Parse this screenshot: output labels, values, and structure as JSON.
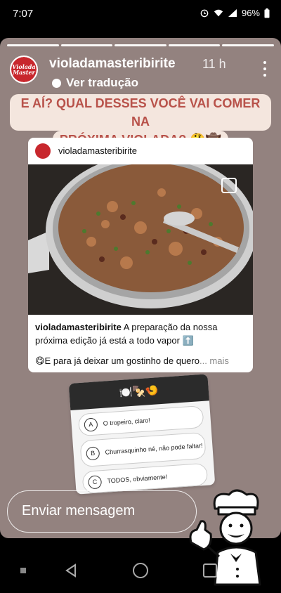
{
  "status": {
    "time": "7:07",
    "battery": "96%"
  },
  "story": {
    "username": "violadamasteribirite",
    "posted_ago": "11 h",
    "translate_label": "Ver tradução",
    "question_line1": "E AÍ? QUAL DESSES VOCÊ VAI COMER NA",
    "question_line2": "PRÓXIMA VIOLADA? 🤔🤠"
  },
  "post": {
    "username": "violadamasteribirite",
    "caption_user": "violadamasteribirite",
    "caption_text": " A preparação da nossa próxima edição já está a todo vapor ⬆️",
    "caption_text2": "😋E para já deixar um gostinho de quero",
    "caption_more": "... mais",
    "watermark": "Violada Master"
  },
  "avatar_text": "Violada Master",
  "poll": {
    "header": "🍽️🍢🍤",
    "options": [
      {
        "letter": "A",
        "text": "O tropeiro, claro!"
      },
      {
        "letter": "B",
        "text": "Churrasquinho né, não pode faltar!"
      },
      {
        "letter": "C",
        "text": "TODOS, obviamente!"
      }
    ]
  },
  "message": {
    "placeholder": "Enviar mensagem"
  },
  "colors": {
    "story_bg": "#93827f",
    "question_text": "#b8524a",
    "question_bg": "#f4e6de",
    "brand_red": "#c8272d"
  }
}
